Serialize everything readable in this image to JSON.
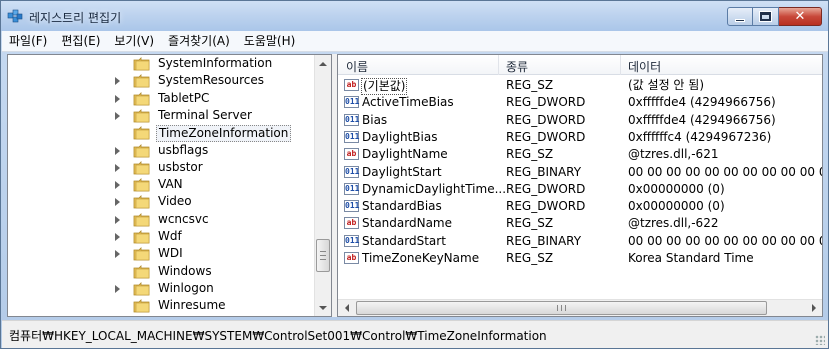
{
  "window": {
    "title": "레지스트리 편집기"
  },
  "menu": [
    "파일(F)",
    "편집(E)",
    "보기(V)",
    "즐겨찾기(A)",
    "도움말(H)"
  ],
  "tree": [
    {
      "label": "SystemInformation",
      "expandable": false,
      "selected": false
    },
    {
      "label": "SystemResources",
      "expandable": true,
      "selected": false
    },
    {
      "label": "TabletPC",
      "expandable": true,
      "selected": false
    },
    {
      "label": "Terminal Server",
      "expandable": true,
      "selected": false
    },
    {
      "label": "TimeZoneInformation",
      "expandable": false,
      "selected": true
    },
    {
      "label": "usbflags",
      "expandable": true,
      "selected": false
    },
    {
      "label": "usbstor",
      "expandable": true,
      "selected": false
    },
    {
      "label": "VAN",
      "expandable": true,
      "selected": false
    },
    {
      "label": "Video",
      "expandable": true,
      "selected": false
    },
    {
      "label": "wcncsvc",
      "expandable": true,
      "selected": false
    },
    {
      "label": "Wdf",
      "expandable": true,
      "selected": false
    },
    {
      "label": "WDI",
      "expandable": true,
      "selected": false
    },
    {
      "label": "Windows",
      "expandable": false,
      "selected": false
    },
    {
      "label": "Winlogon",
      "expandable": true,
      "selected": false
    },
    {
      "label": "Winresume",
      "expandable": false,
      "selected": false
    }
  ],
  "columns": {
    "name": "이름",
    "type": "종류",
    "data": "데이터"
  },
  "values": [
    {
      "icon": "string-value-icon",
      "kind": "sz",
      "glyph": "ab",
      "name": "(기본값)",
      "type": "REG_SZ",
      "data": "(값 설정 안 됨)",
      "default": true
    },
    {
      "icon": "binary-value-icon",
      "kind": "bin",
      "glyph": "011",
      "name": "ActiveTimeBias",
      "type": "REG_DWORD",
      "data": "0xfffffde4 (4294966756)"
    },
    {
      "icon": "binary-value-icon",
      "kind": "bin",
      "glyph": "011",
      "name": "Bias",
      "type": "REG_DWORD",
      "data": "0xfffffde4 (4294966756)"
    },
    {
      "icon": "binary-value-icon",
      "kind": "bin",
      "glyph": "011",
      "name": "DaylightBias",
      "type": "REG_DWORD",
      "data": "0xffffffc4 (4294967236)"
    },
    {
      "icon": "string-value-icon",
      "kind": "sz",
      "glyph": "ab",
      "name": "DaylightName",
      "type": "REG_SZ",
      "data": "@tzres.dll,-621"
    },
    {
      "icon": "binary-value-icon",
      "kind": "bin",
      "glyph": "011",
      "name": "DaylightStart",
      "type": "REG_BINARY",
      "data": "00 00 00 00 00 00 00 00 00 00 00"
    },
    {
      "icon": "binary-value-icon",
      "kind": "bin",
      "glyph": "011",
      "name": "DynamicDaylightTime...",
      "type": "REG_DWORD",
      "data": "0x00000000 (0)"
    },
    {
      "icon": "binary-value-icon",
      "kind": "bin",
      "glyph": "011",
      "name": "StandardBias",
      "type": "REG_DWORD",
      "data": "0x00000000 (0)"
    },
    {
      "icon": "string-value-icon",
      "kind": "sz",
      "glyph": "ab",
      "name": "StandardName",
      "type": "REG_SZ",
      "data": "@tzres.dll,-622"
    },
    {
      "icon": "binary-value-icon",
      "kind": "bin",
      "glyph": "011",
      "name": "StandardStart",
      "type": "REG_BINARY",
      "data": "00 00 00 00 00 00 00 00 00 00 00"
    },
    {
      "icon": "string-value-icon",
      "kind": "sz",
      "glyph": "ab",
      "name": "TimeZoneKeyName",
      "type": "REG_SZ",
      "data": "Korea Standard Time"
    }
  ],
  "hscroll_glyph": "III",
  "status": "컴퓨터₩HKEY_LOCAL_MACHINE₩SYSTEM₩ControlSet001₩Control₩TimeZoneInformation",
  "colors": {
    "folder": "#e8c25a",
    "titlebar": "#bcd2ee",
    "close": "#c8483a"
  }
}
